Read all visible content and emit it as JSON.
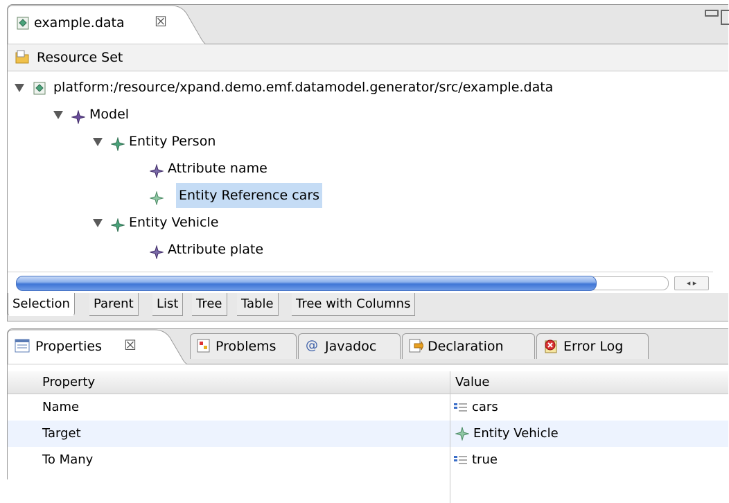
{
  "editor": {
    "tab_title": "example.data",
    "close_glyph": "☒",
    "resource_set_label": "Resource Set",
    "tree": [
      {
        "label": "platform:/resource/xpand.demo.emf.datamodel.generator/src/example.data",
        "icon": "data-file-icon"
      },
      {
        "label": "Model",
        "icon": "model-diamond-icon"
      },
      {
        "label": "Entity Person",
        "icon": "entity-diamond-icon"
      },
      {
        "label": "Attribute name",
        "icon": "attribute-diamond-icon"
      },
      {
        "label": "Entity Reference cars",
        "icon": "reference-diamond-icon",
        "selected": true
      },
      {
        "label": "Entity Vehicle",
        "icon": "entity-diamond-icon"
      },
      {
        "label": "Attribute plate",
        "icon": "attribute-diamond-icon"
      }
    ],
    "scroll_arrows": "◂ ▸",
    "page_tabs": [
      "Selection",
      "Parent",
      "List",
      "Tree",
      "Table",
      "Tree with Columns"
    ],
    "active_page_tab": "Selection"
  },
  "properties": {
    "tabs": [
      {
        "label": "Properties",
        "icon": "properties-icon",
        "active": true
      },
      {
        "label": "Problems",
        "icon": "problems-icon"
      },
      {
        "label": "Javadoc",
        "icon": "javadoc-icon"
      },
      {
        "label": "Declaration",
        "icon": "declaration-icon"
      },
      {
        "label": "Error Log",
        "icon": "error-log-icon"
      }
    ],
    "javadoc_glyph": "@",
    "columns": [
      "Property",
      "Value"
    ],
    "rows": [
      {
        "property": "Name",
        "value": "cars",
        "value_icon": "text-value-icon"
      },
      {
        "property": "Target",
        "value": "Entity Vehicle",
        "value_icon": "entity-diamond-icon"
      },
      {
        "property": "To Many",
        "value": "true",
        "value_icon": "text-value-icon"
      }
    ]
  },
  "colors": {
    "selection": "#c5dcf5",
    "alt_row": "#edf3fe",
    "entity_green": "#4aa37a",
    "model_purple": "#6a4c9c"
  }
}
